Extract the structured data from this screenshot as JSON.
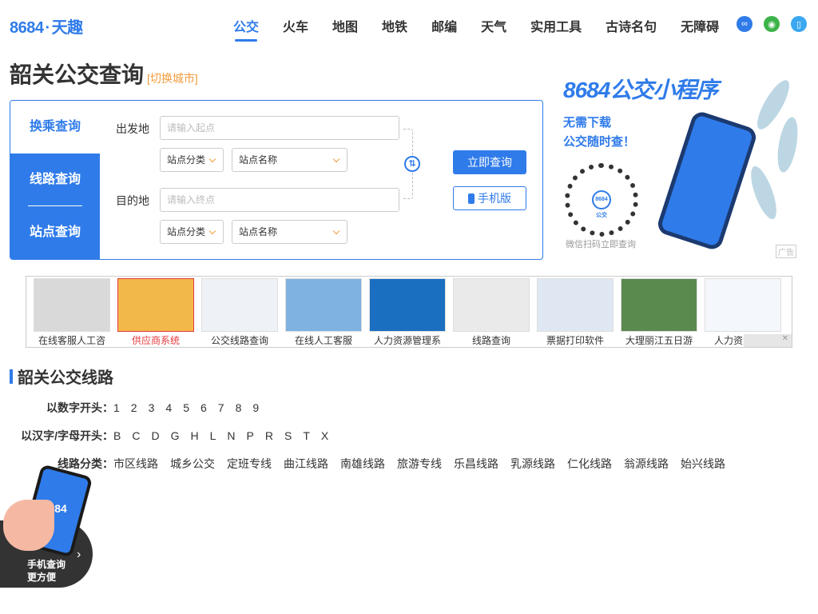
{
  "header": {
    "logo_num": "8684",
    "logo_dot": "·",
    "logo_text": "天趣",
    "nav": [
      "公交",
      "火车",
      "地图",
      "地铁",
      "邮编",
      "天气",
      "实用工具",
      "古诗名句",
      "无障碍"
    ],
    "active_nav": "公交",
    "icons": [
      {
        "name": "mini-program-icon",
        "color": "#2f7bea"
      },
      {
        "name": "wechat-icon",
        "color": "#3cb34a"
      },
      {
        "name": "mobile-icon",
        "color": "#3aa7f0"
      }
    ]
  },
  "page": {
    "title": "韶关公交查询",
    "switch_city": "[切换城市]"
  },
  "search": {
    "tabs": [
      "换乘查询",
      "线路查询",
      "站点查询"
    ],
    "from_label": "出发地",
    "from_placeholder": "请输入起点",
    "to_label": "目的地",
    "to_placeholder": "请输入终点",
    "select_category": "站点分类",
    "select_name": "站点名称",
    "query_button": "立即查询",
    "mobile_button": "手机版"
  },
  "ad": {
    "title": "8684公交小程序",
    "line1": "无需下载",
    "line2": "公交随时查！",
    "qr_label": "8684公交",
    "qr_caption": "微信扫码立即查询",
    "tag": "广告"
  },
  "strip": {
    "items": [
      {
        "label": "在线客服人工咨",
        "red": false,
        "bg": "#d9d9d9"
      },
      {
        "label": "供应商系统",
        "red": true,
        "bg": "#f3b84a"
      },
      {
        "label": "公交线路查询",
        "red": false,
        "bg": "#eef2f6"
      },
      {
        "label": "在线人工客服",
        "red": false,
        "bg": "#7fb2e0"
      },
      {
        "label": "人力资源管理系",
        "red": false,
        "bg": "#1a6fc0"
      },
      {
        "label": "线路查询",
        "red": false,
        "bg": "#eaeaea"
      },
      {
        "label": "票据打印软件",
        "red": false,
        "bg": "#dfe8f2"
      },
      {
        "label": "大理丽江五日游",
        "red": false,
        "bg": "#5a8a4e"
      },
      {
        "label": "人力资源系统",
        "red": false,
        "bg": "#f4f7fb"
      }
    ]
  },
  "lines": {
    "section_title": "韶关公交线路",
    "digit_label": "以数字开头：",
    "digits": [
      "1",
      "2",
      "3",
      "4",
      "5",
      "6",
      "7",
      "8",
      "9"
    ],
    "letter_label": "以汉字/字母开头：",
    "letters": [
      "B",
      "C",
      "D",
      "G",
      "H",
      "L",
      "N",
      "P",
      "R",
      "S",
      "T",
      "X"
    ],
    "category_label": "线路分类：",
    "categories": [
      "市区线路",
      "城乡公交",
      "定班专线",
      "曲江线路",
      "南雄线路",
      "旅游专线",
      "乐昌线路",
      "乳源线路",
      "仁化线路",
      "翁源线路",
      "始兴线路"
    ]
  },
  "float_ad": {
    "line1": "手机查询",
    "line2": "更方便",
    "phone_text": "8684"
  }
}
